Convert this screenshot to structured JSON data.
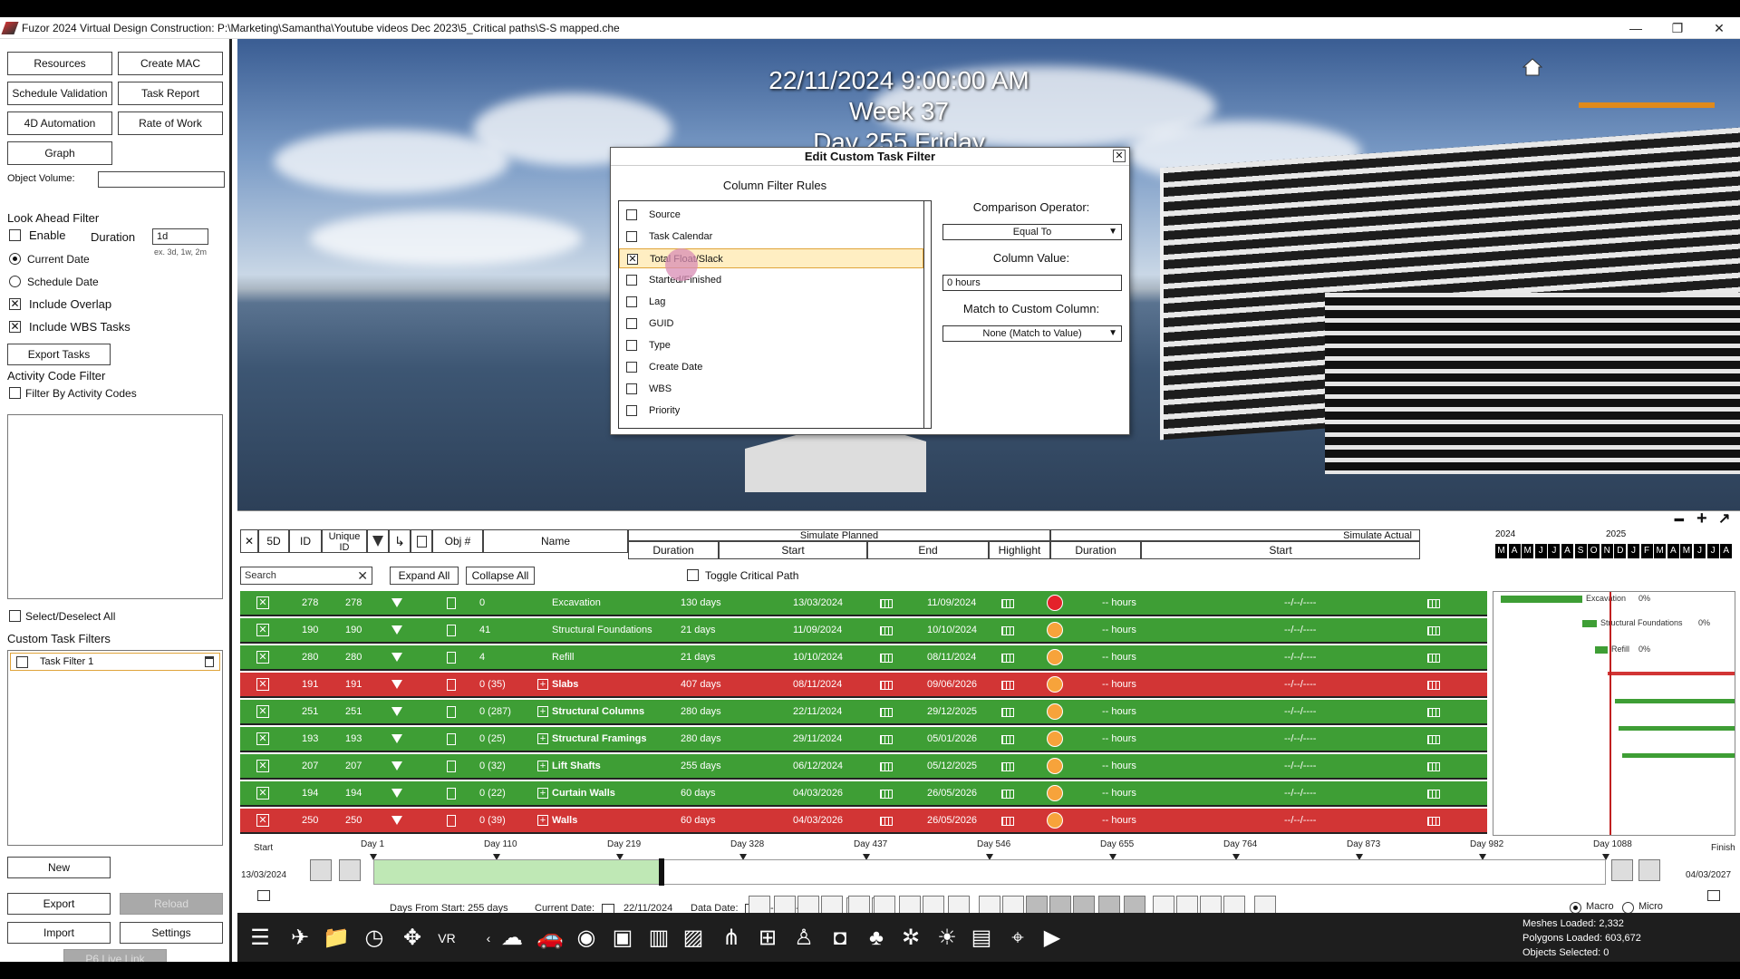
{
  "window": {
    "title": "Fuzor 2024 Virtual Design Construction: P:\\Marketing\\Samantha\\Youtube videos Dec 2023\\5_Critical paths\\S-S mapped.che",
    "minimize": "—",
    "restore": "❐",
    "close": "✕"
  },
  "left": {
    "resources": "Resources",
    "create_mac": "Create MAC",
    "schedule_validation": "Schedule Validation",
    "task_report": "Task Report",
    "automation_4d": "4D Automation",
    "rate_of_work": "Rate of Work",
    "graph": "Graph",
    "object_volume": "Object Volume:",
    "look_ahead_filter": "Look Ahead Filter",
    "enable": "Enable",
    "duration": "Duration",
    "duration_value": "1d",
    "duration_hint": "ex. 3d, 1w, 2m",
    "current_date": "Current Date",
    "schedule_date": "Schedule Date",
    "include_overlap": "Include Overlap",
    "include_wbs": "Include WBS Tasks",
    "export_tasks": "Export Tasks",
    "activity_code_filter": "Activity Code Filter",
    "filter_by_activity": "Filter By Activity Codes",
    "select_deselect_all": "Select/Deselect All",
    "custom_task_filters": "Custom Task Filters",
    "task_filter_1": "Task Filter 1",
    "new": "New",
    "export": "Export",
    "reload": "Reload",
    "import": "Import",
    "settings": "Settings",
    "p6_live_link": "P6 Live Link"
  },
  "viewport": {
    "datetime": "22/11/2024 9:00:00 AM",
    "week": "Week 37",
    "day": "Day 255 Friday"
  },
  "dialog": {
    "title": "Edit Custom Task Filter",
    "close": "✕",
    "column_filter_rules": "Column Filter Rules",
    "rules": [
      {
        "label": "Source",
        "checked": false
      },
      {
        "label": "Task Calendar",
        "checked": false
      },
      {
        "label": "Total Float/Slack",
        "checked": true
      },
      {
        "label": "Started/Finished",
        "checked": false
      },
      {
        "label": "Lag",
        "checked": false
      },
      {
        "label": "GUID",
        "checked": false
      },
      {
        "label": "Type",
        "checked": false
      },
      {
        "label": "Create Date",
        "checked": false
      },
      {
        "label": "WBS",
        "checked": false
      },
      {
        "label": "Priority",
        "checked": false
      }
    ],
    "comparison_operator_label": "Comparison Operator:",
    "comparison_operator_value": "Equal To",
    "column_value_label": "Column Value:",
    "column_value": "0 hours",
    "match_label": "Match to Custom Column:",
    "match_value": "None (Match to Value)"
  },
  "gantt": {
    "header": {
      "x": "✕",
      "fived": "5D",
      "id": "ID",
      "unique_id": "Unique ID",
      "obj": "Obj #",
      "name": "Name",
      "simulate_planned": "Simulate Planned",
      "simulate_actual": "Simulate Actual",
      "duration": "Duration",
      "start": "Start",
      "end": "End",
      "highlight": "Highlight",
      "actual_duration": "Duration",
      "actual_start": "Start",
      "year1": "2024",
      "year2": "2025",
      "months": [
        "M",
        "A",
        "M",
        "J",
        "J",
        "A",
        "S",
        "O",
        "N",
        "D",
        "J",
        "F",
        "M",
        "A",
        "M",
        "J",
        "J",
        "A"
      ]
    },
    "search_placeholder": "Search",
    "expand_all": "Expand All",
    "collapse_all": "Collapse All",
    "toggle_critical": "Toggle Critical Path",
    "rows": [
      {
        "id": "278",
        "uid": "278",
        "obj": "0",
        "name": "Excavation",
        "dur": "130 days",
        "start": "13/03/2024",
        "end": "11/09/2024",
        "adur": "-- hours",
        "astart": "--/--/----",
        "color": "green",
        "group": false,
        "palette": "red"
      },
      {
        "id": "190",
        "uid": "190",
        "obj": "41",
        "name": "Structural Foundations",
        "dur": "21 days",
        "start": "11/09/2024",
        "end": "10/10/2024",
        "adur": "-- hours",
        "astart": "--/--/----",
        "color": "green",
        "group": false,
        "palette": "orange"
      },
      {
        "id": "280",
        "uid": "280",
        "obj": "4",
        "name": "Refill",
        "dur": "21 days",
        "start": "10/10/2024",
        "end": "08/11/2024",
        "adur": "-- hours",
        "astart": "--/--/----",
        "color": "green",
        "group": false,
        "palette": "orange"
      },
      {
        "id": "191",
        "uid": "191",
        "obj": "0 (35)",
        "name": "Slabs",
        "dur": "407 days",
        "start": "08/11/2024",
        "end": "09/06/2026",
        "adur": "-- hours",
        "astart": "--/--/----",
        "color": "red",
        "group": true,
        "palette": "orange"
      },
      {
        "id": "251",
        "uid": "251",
        "obj": "0 (287)",
        "name": "Structural Columns",
        "dur": "280 days",
        "start": "22/11/2024",
        "end": "29/12/2025",
        "adur": "-- hours",
        "astart": "--/--/----",
        "color": "green",
        "group": true,
        "palette": "orange"
      },
      {
        "id": "193",
        "uid": "193",
        "obj": "0 (25)",
        "name": "Structural Framings",
        "dur": "280 days",
        "start": "29/11/2024",
        "end": "05/01/2026",
        "adur": "-- hours",
        "astart": "--/--/----",
        "color": "green",
        "group": true,
        "palette": "orange"
      },
      {
        "id": "207",
        "uid": "207",
        "obj": "0 (32)",
        "name": "Lift Shafts",
        "dur": "255 days",
        "start": "06/12/2024",
        "end": "05/12/2025",
        "adur": "-- hours",
        "astart": "--/--/----",
        "color": "green",
        "group": true,
        "palette": "orange"
      },
      {
        "id": "194",
        "uid": "194",
        "obj": "0 (22)",
        "name": "Curtain Walls",
        "dur": "60 days",
        "start": "04/03/2026",
        "end": "26/05/2026",
        "adur": "-- hours",
        "astart": "--/--/----",
        "color": "green",
        "group": true,
        "palette": "orange"
      },
      {
        "id": "250",
        "uid": "250",
        "obj": "0 (39)",
        "name": "Walls",
        "dur": "60 days",
        "start": "04/03/2026",
        "end": "26/05/2026",
        "adur": "-- hours",
        "astart": "--/--/----",
        "color": "red",
        "group": true,
        "palette": "orange"
      }
    ],
    "chart_labels": {
      "excavation": "Excavation",
      "excavation_pct": "0%",
      "foundations": "Structural Foundations",
      "foundations_pct": "0%",
      "refill": "Refill",
      "refill_pct": "0%"
    }
  },
  "timeline": {
    "start": "Start",
    "finish": "Finish",
    "start_date": "13/03/2024",
    "finish_date": "04/03/2027",
    "days": [
      "Day 1",
      "Day 110",
      "Day 219",
      "Day 328",
      "Day 437",
      "Day 546",
      "Day 655",
      "Day 764",
      "Day 873",
      "Day 982",
      "Day 1088"
    ],
    "days_from_start_label": "Days From Start:",
    "days_from_start": "255 days",
    "current_date_label": "Current Date:",
    "current_date": "22/11/2024",
    "data_date_label": "Data Date:",
    "data_date": "--/--/----",
    "macro": "Macro",
    "micro": "Micro"
  },
  "status": {
    "meshes": "Meshes Loaded: 2,332",
    "polygons": "Polygons Loaded: 603,672",
    "objects": "Objects Selected: 0"
  }
}
